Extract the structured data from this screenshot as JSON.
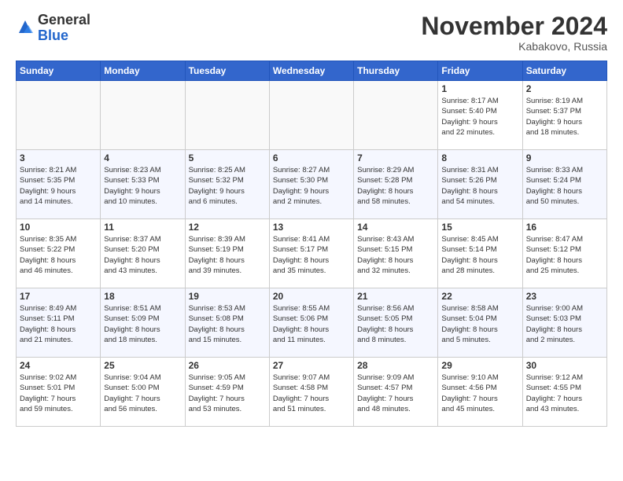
{
  "header": {
    "logo_general": "General",
    "logo_blue": "Blue",
    "month_title": "November 2024",
    "location": "Kabakovo, Russia"
  },
  "weekdays": [
    "Sunday",
    "Monday",
    "Tuesday",
    "Wednesday",
    "Thursday",
    "Friday",
    "Saturday"
  ],
  "weeks": [
    [
      {
        "day": "",
        "info": ""
      },
      {
        "day": "",
        "info": ""
      },
      {
        "day": "",
        "info": ""
      },
      {
        "day": "",
        "info": ""
      },
      {
        "day": "",
        "info": ""
      },
      {
        "day": "1",
        "info": "Sunrise: 8:17 AM\nSunset: 5:40 PM\nDaylight: 9 hours\nand 22 minutes."
      },
      {
        "day": "2",
        "info": "Sunrise: 8:19 AM\nSunset: 5:37 PM\nDaylight: 9 hours\nand 18 minutes."
      }
    ],
    [
      {
        "day": "3",
        "info": "Sunrise: 8:21 AM\nSunset: 5:35 PM\nDaylight: 9 hours\nand 14 minutes."
      },
      {
        "day": "4",
        "info": "Sunrise: 8:23 AM\nSunset: 5:33 PM\nDaylight: 9 hours\nand 10 minutes."
      },
      {
        "day": "5",
        "info": "Sunrise: 8:25 AM\nSunset: 5:32 PM\nDaylight: 9 hours\nand 6 minutes."
      },
      {
        "day": "6",
        "info": "Sunrise: 8:27 AM\nSunset: 5:30 PM\nDaylight: 9 hours\nand 2 minutes."
      },
      {
        "day": "7",
        "info": "Sunrise: 8:29 AM\nSunset: 5:28 PM\nDaylight: 8 hours\nand 58 minutes."
      },
      {
        "day": "8",
        "info": "Sunrise: 8:31 AM\nSunset: 5:26 PM\nDaylight: 8 hours\nand 54 minutes."
      },
      {
        "day": "9",
        "info": "Sunrise: 8:33 AM\nSunset: 5:24 PM\nDaylight: 8 hours\nand 50 minutes."
      }
    ],
    [
      {
        "day": "10",
        "info": "Sunrise: 8:35 AM\nSunset: 5:22 PM\nDaylight: 8 hours\nand 46 minutes."
      },
      {
        "day": "11",
        "info": "Sunrise: 8:37 AM\nSunset: 5:20 PM\nDaylight: 8 hours\nand 43 minutes."
      },
      {
        "day": "12",
        "info": "Sunrise: 8:39 AM\nSunset: 5:19 PM\nDaylight: 8 hours\nand 39 minutes."
      },
      {
        "day": "13",
        "info": "Sunrise: 8:41 AM\nSunset: 5:17 PM\nDaylight: 8 hours\nand 35 minutes."
      },
      {
        "day": "14",
        "info": "Sunrise: 8:43 AM\nSunset: 5:15 PM\nDaylight: 8 hours\nand 32 minutes."
      },
      {
        "day": "15",
        "info": "Sunrise: 8:45 AM\nSunset: 5:14 PM\nDaylight: 8 hours\nand 28 minutes."
      },
      {
        "day": "16",
        "info": "Sunrise: 8:47 AM\nSunset: 5:12 PM\nDaylight: 8 hours\nand 25 minutes."
      }
    ],
    [
      {
        "day": "17",
        "info": "Sunrise: 8:49 AM\nSunset: 5:11 PM\nDaylight: 8 hours\nand 21 minutes."
      },
      {
        "day": "18",
        "info": "Sunrise: 8:51 AM\nSunset: 5:09 PM\nDaylight: 8 hours\nand 18 minutes."
      },
      {
        "day": "19",
        "info": "Sunrise: 8:53 AM\nSunset: 5:08 PM\nDaylight: 8 hours\nand 15 minutes."
      },
      {
        "day": "20",
        "info": "Sunrise: 8:55 AM\nSunset: 5:06 PM\nDaylight: 8 hours\nand 11 minutes."
      },
      {
        "day": "21",
        "info": "Sunrise: 8:56 AM\nSunset: 5:05 PM\nDaylight: 8 hours\nand 8 minutes."
      },
      {
        "day": "22",
        "info": "Sunrise: 8:58 AM\nSunset: 5:04 PM\nDaylight: 8 hours\nand 5 minutes."
      },
      {
        "day": "23",
        "info": "Sunrise: 9:00 AM\nSunset: 5:03 PM\nDaylight: 8 hours\nand 2 minutes."
      }
    ],
    [
      {
        "day": "24",
        "info": "Sunrise: 9:02 AM\nSunset: 5:01 PM\nDaylight: 7 hours\nand 59 minutes."
      },
      {
        "day": "25",
        "info": "Sunrise: 9:04 AM\nSunset: 5:00 PM\nDaylight: 7 hours\nand 56 minutes."
      },
      {
        "day": "26",
        "info": "Sunrise: 9:05 AM\nSunset: 4:59 PM\nDaylight: 7 hours\nand 53 minutes."
      },
      {
        "day": "27",
        "info": "Sunrise: 9:07 AM\nSunset: 4:58 PM\nDaylight: 7 hours\nand 51 minutes."
      },
      {
        "day": "28",
        "info": "Sunrise: 9:09 AM\nSunset: 4:57 PM\nDaylight: 7 hours\nand 48 minutes."
      },
      {
        "day": "29",
        "info": "Sunrise: 9:10 AM\nSunset: 4:56 PM\nDaylight: 7 hours\nand 45 minutes."
      },
      {
        "day": "30",
        "info": "Sunrise: 9:12 AM\nSunset: 4:55 PM\nDaylight: 7 hours\nand 43 minutes."
      }
    ]
  ]
}
